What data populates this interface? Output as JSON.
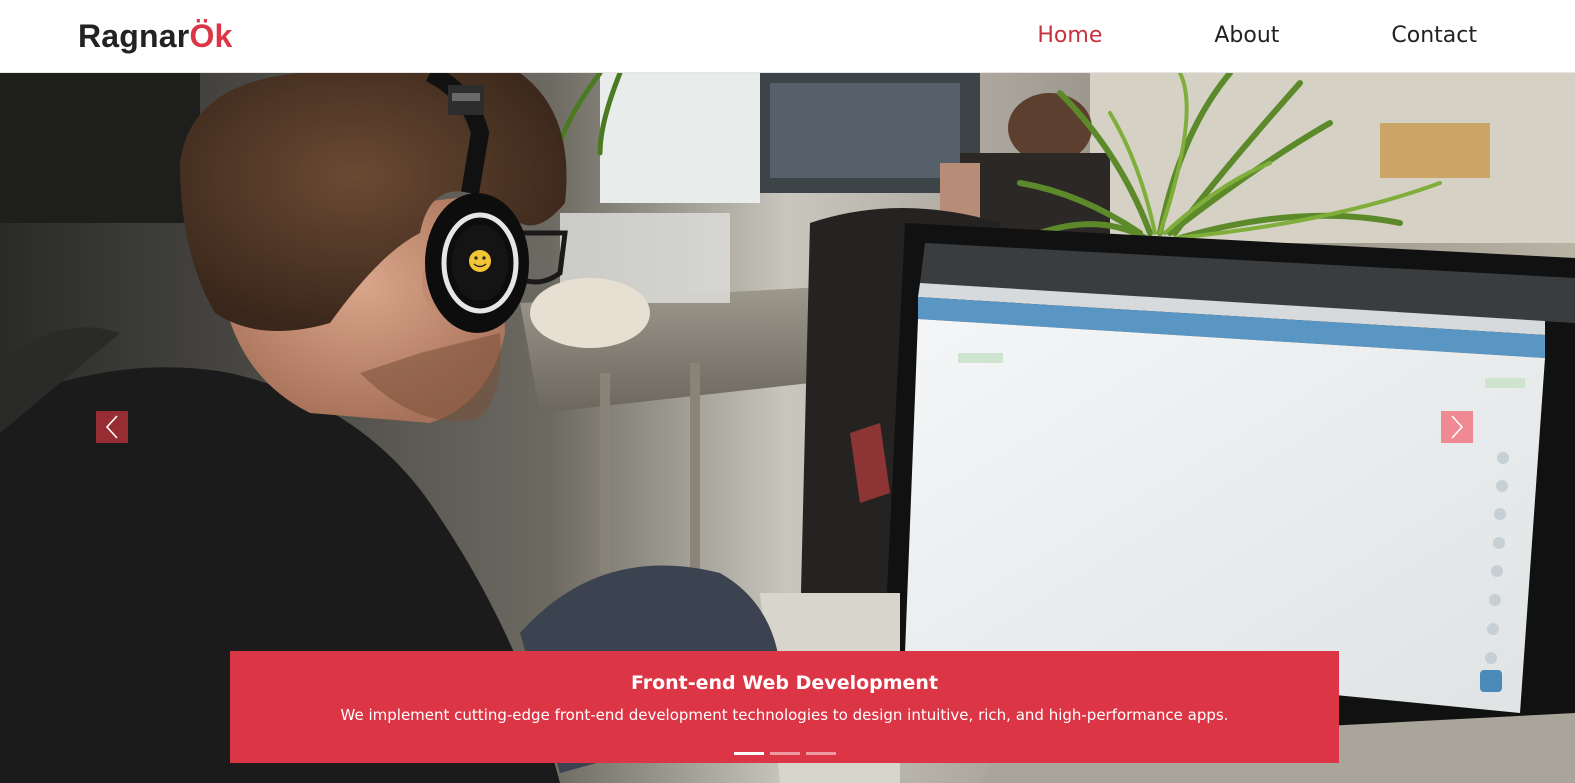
{
  "brand": {
    "text_main": "Ragnar",
    "text_accent": "Ök",
    "accent_color": "#dc3545"
  },
  "nav": {
    "items": [
      {
        "label": "Home",
        "active": true
      },
      {
        "label": "About",
        "active": false
      },
      {
        "label": "Contact",
        "active": false
      }
    ],
    "active_color": "#c8313d"
  },
  "carousel": {
    "controls": {
      "prev_icon": "chevron-left-icon",
      "next_icon": "chevron-right-icon"
    },
    "caption": {
      "title": "Front-end Web Development",
      "text": "We implement cutting-edge front-end development technologies to design intuitive, rich, and high-performance apps.",
      "background": "#dc3545"
    },
    "indicators": {
      "count": 3,
      "active_index": 0
    }
  }
}
